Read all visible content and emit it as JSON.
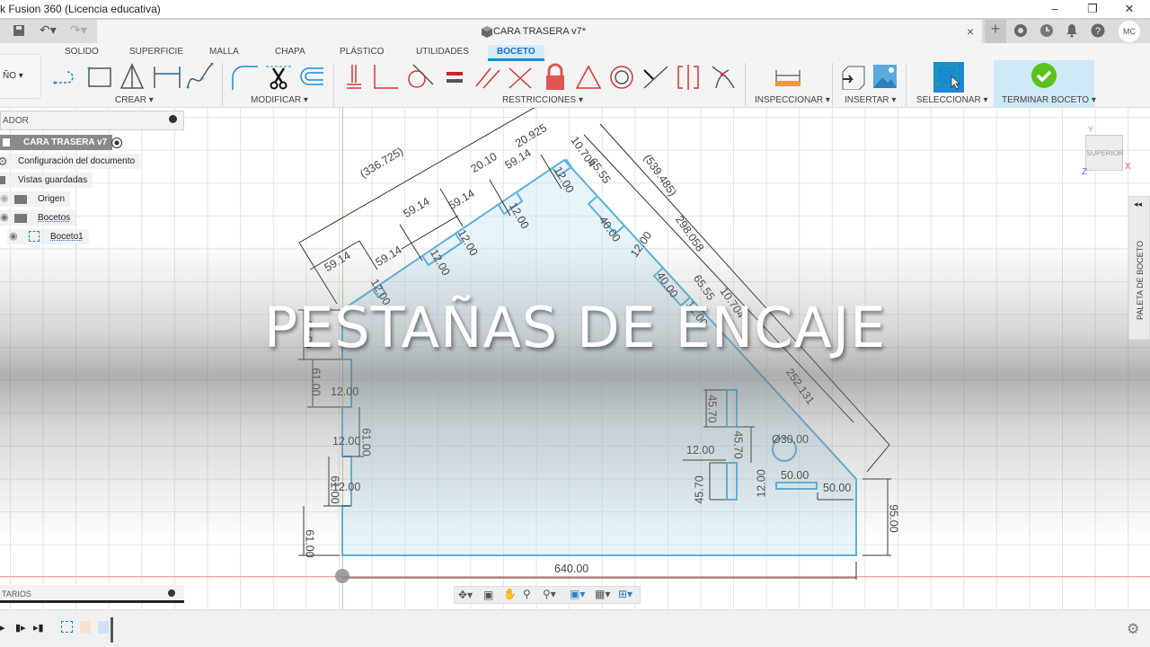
{
  "window": {
    "title": "k Fusion 360 (Licencia educativa)",
    "minimize": "–",
    "maximize": "❐",
    "close": "✕"
  },
  "document": {
    "tab_title": "CARA TRASERA v7*",
    "close": "×",
    "new_tab": "+",
    "user_initials": "MC"
  },
  "ribbon": {
    "workspace_label": "ÑO ▾",
    "tabs": [
      {
        "label": "SOLIDO"
      },
      {
        "label": "SUPERFICIE"
      },
      {
        "label": "MALLA"
      },
      {
        "label": "CHAPA"
      },
      {
        "label": "PLÁSTICO"
      },
      {
        "label": "UTILIDADES"
      },
      {
        "label": "BOCETO",
        "active": true
      }
    ],
    "groups": {
      "create": "CREAR ▾",
      "modify": "MODIFICAR ▾",
      "constraints": "RESTRICCIONES ▾",
      "inspect": "INSPECCIONAR ▾",
      "insert": "INSERTAR ▾",
      "select": "SELECCIONAR ▾",
      "finish": "TERMINAR BOCETO ▾"
    },
    "accent_color": "#1a8ad4",
    "finish_color": "#5cc21c"
  },
  "browser": {
    "header": "ADOR",
    "items": [
      {
        "label": "CARA TRASERA v7",
        "icon": "component-icon"
      },
      {
        "label": "Configuración del documento",
        "icon": "gear-icon"
      },
      {
        "label": "Vistas guardadas",
        "icon": "folder-icon"
      },
      {
        "label": "Origen",
        "icon": "folder-icon"
      },
      {
        "label": "Bocetos",
        "icon": "folder-icon"
      },
      {
        "label": "Boceto1",
        "icon": "sketch-icon"
      }
    ]
  },
  "comments": {
    "label": "TARIOS"
  },
  "viewcube": {
    "face": "SUPERIOR",
    "x": "X",
    "y": "Y",
    "z": "Z"
  },
  "palette": {
    "label": "PALETA DE BOCETO",
    "collapse": "◂◂"
  },
  "overlay": {
    "title": "PESTAÑAS DE ENCAJE"
  },
  "sketch": {
    "profile_color": "#5ab4dc",
    "dimensions": [
      "(336.725)",
      "59.14",
      "59.14",
      "59.14",
      "59.14",
      "59.14",
      "20.10",
      "20.925",
      "10.704",
      "65.55",
      "12.00",
      "12.00",
      "12.00",
      "12.00",
      "12.00",
      "40.00",
      "(539.485)",
      "298.058",
      "12.00",
      "40.00",
      "65.55",
      "10.704",
      "12.00",
      "252.131",
      "61.00",
      "61.00",
      "12.00",
      "61.00",
      "12.00",
      "61.00",
      "12.00",
      "61.00",
      "45.70",
      "45.70",
      "12.00",
      "45.70",
      "Ø30.00",
      "12.00",
      "50.00",
      "50.00",
      "95.00",
      "640.00"
    ]
  }
}
